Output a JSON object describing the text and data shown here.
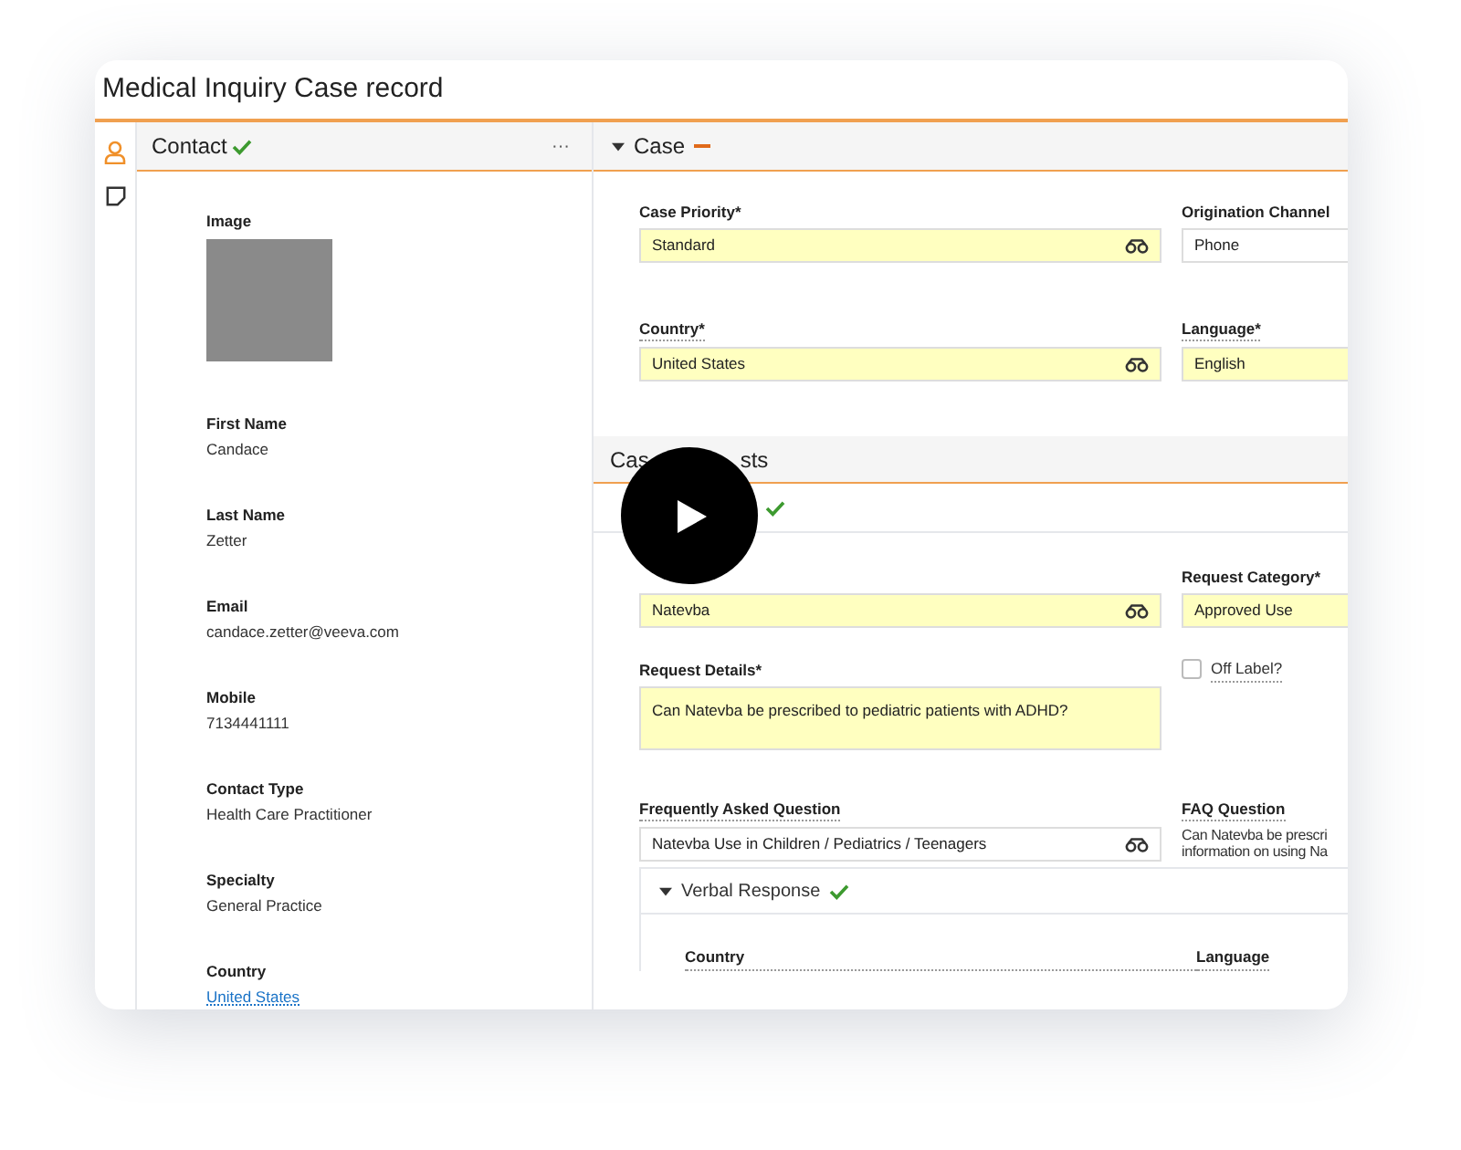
{
  "window": {
    "title": "Medical Inquiry Case record"
  },
  "rail": [
    {
      "selected": true
    },
    {
      "selected": false
    }
  ],
  "contact": {
    "title": "Contact",
    "complete": true,
    "menu": "···",
    "image_label": "Image",
    "fields": [
      {
        "label": "First Name",
        "value": "Candace",
        "link": false
      },
      {
        "label": "Last Name",
        "value": "Zetter",
        "link": false
      },
      {
        "label": "Email",
        "value": "candace.zetter@veeva.com",
        "link": false
      },
      {
        "label": "Mobile",
        "value": "7134441111",
        "link": false
      },
      {
        "label": "Contact Type",
        "value": "Health Care Practitioner",
        "link": false
      },
      {
        "label": "Specialty",
        "value": "General Practice",
        "link": false
      },
      {
        "label": "Country",
        "value": "United States",
        "link": true
      }
    ]
  },
  "case": {
    "title": "Case",
    "expanded": true,
    "fields": [
      {
        "label": "Case Priority*",
        "value": "Standard",
        "required": true,
        "lookup": true
      },
      {
        "label": "Origination Channel",
        "value": "Phone",
        "required": false
      },
      {
        "label": "Country*",
        "value": "United States",
        "required": true,
        "lookup": true
      },
      {
        "label": "Language*",
        "value": "English",
        "required": true
      }
    ]
  },
  "case_requests": {
    "title_parts": [
      "Cas",
      "sts"
    ],
    "request_complete": true,
    "fields": [
      {
        "kind": "field",
        "value": "Natevba",
        "required": true,
        "lookup": true
      },
      {
        "kind": "field",
        "label": "Request Category*",
        "value": "Approved Use",
        "required": true
      },
      {
        "kind": "textarea",
        "label": "Request Details*",
        "value": "Can Natevba be prescribed to pediatric patients with ADHD?",
        "required": true,
        "lookup": false
      },
      {
        "kind": "checkbox",
        "label": "Off Label?",
        "checked": false
      },
      {
        "kind": "field",
        "label": "Frequently Asked Question",
        "value": "Natevba Use in Children / Pediatrics / Teenagers",
        "required": false,
        "lookup": true
      },
      {
        "kind": "text",
        "label": "FAQ Question",
        "lines": [
          "Can Natevba be prescri",
          "information on using Na"
        ]
      }
    ],
    "verbal_response": {
      "title": "Verbal Response",
      "expanded": true,
      "complete": true,
      "columns": [
        "Country",
        "Language"
      ]
    }
  },
  "video": {
    "play": true
  }
}
